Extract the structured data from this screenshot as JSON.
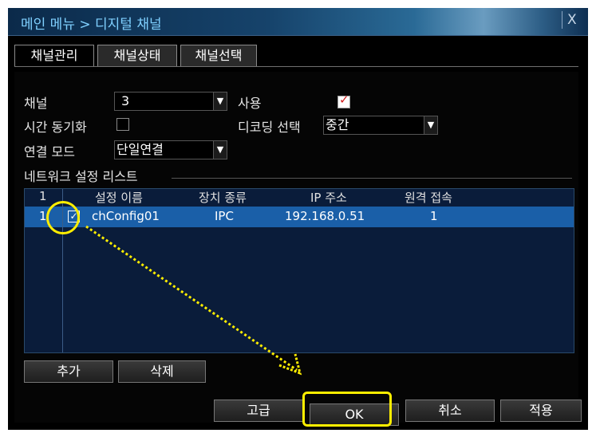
{
  "title": "메인 메뉴 > 디지털 채널",
  "close_label": "X",
  "tabs": [
    {
      "label": "채널관리"
    },
    {
      "label": "채널상태"
    },
    {
      "label": "채널선택"
    }
  ],
  "form": {
    "channel_label": "채널",
    "channel_value": "3",
    "enable_label": "사용",
    "enable_checked": true,
    "time_sync_label": "시간 동기화",
    "time_sync_checked": false,
    "decoding_label": "디코딩 선택",
    "decoding_value": "중간",
    "connect_mode_label": "연결 모드",
    "connect_mode_value": "단일연결"
  },
  "network_list": {
    "section_label": "네트워크 설정 리스트",
    "columns": [
      "1",
      "설정 이름",
      "장치 종류",
      "IP 주소",
      "원격 접속"
    ],
    "rows": [
      {
        "index": "1",
        "checked": true,
        "name": "chConfig01",
        "device_type": "IPC",
        "ip": "192.168.0.51",
        "remote": "1"
      }
    ]
  },
  "list_buttons": {
    "add": "추가",
    "delete": "삭제"
  },
  "footer_buttons": {
    "advanced": "고급",
    "ok": "OK",
    "cancel": "취소",
    "apply": "적용"
  },
  "colors": {
    "highlight": "#ffee00",
    "selected_row": "#1a5fa8",
    "title_text": "#7fd0ff"
  }
}
